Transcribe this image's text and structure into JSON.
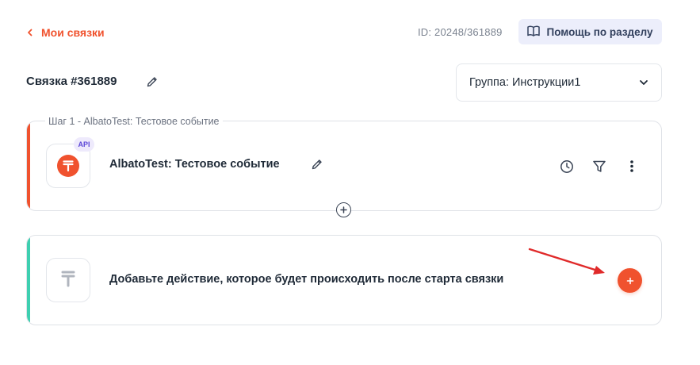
{
  "header": {
    "back_label": "Мои связки",
    "connection_id": "ID: 20248/361889",
    "help_label": "Помощь по разделу"
  },
  "connection": {
    "title": "Связка #361889",
    "group_label": "Группа: Инструкции1"
  },
  "step1": {
    "legend": "Шаг 1 - AlbatoTest: Тестовое событие",
    "name": "AlbatoTest: Тестовое событие",
    "badge": "API"
  },
  "action": {
    "prompt": "Добавьте действие, которое будет происходить после старта связки"
  },
  "colors": {
    "accent_orange": "#f0522e",
    "accent_teal": "#3ecfb0",
    "arrow_red": "#e02a2a",
    "help_bg": "#eceefb"
  },
  "icons": [
    "chevron-left-icon",
    "book-icon",
    "pencil-icon",
    "chevron-down-icon",
    "clock-icon",
    "filter-icon",
    "more-vertical-icon",
    "plus-circle-icon",
    "plus-icon",
    "app-logo-icon",
    "arrow-annotation"
  ]
}
